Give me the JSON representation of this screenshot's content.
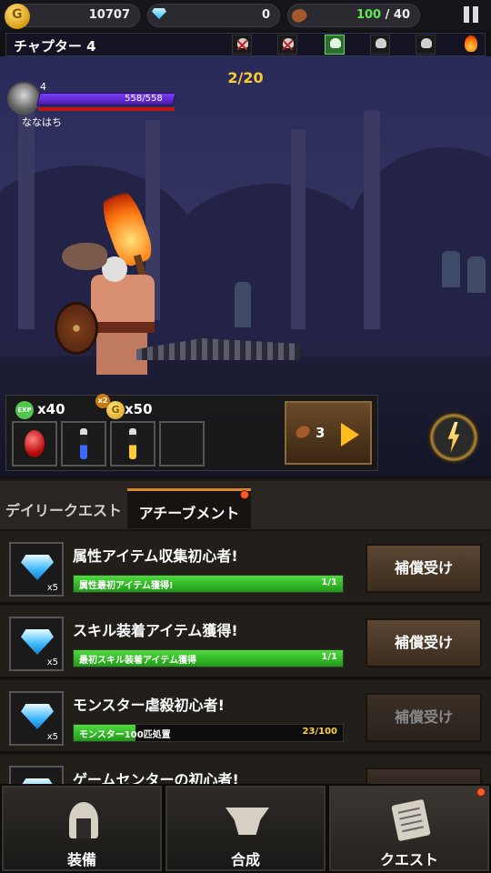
{
  "resources": {
    "gold": "10707",
    "gems": "0",
    "stamina_current": "100",
    "stamina_max": " / 40",
    "gold_icon": "gold-coin-icon",
    "gem_icon": "diamond-icon",
    "stamina_icon": "meat-icon"
  },
  "chapter": {
    "title": "チャプター 4",
    "stages": [
      "done",
      "done",
      "current",
      "pending",
      "pending",
      "boss"
    ]
  },
  "battle": {
    "wave": "2/20",
    "player_level": "4",
    "player_hp": "558/558",
    "player_name": "ななはち",
    "hp_fraction": 1.0
  },
  "rewards": {
    "exp_label": "EXP",
    "exp": "x40",
    "gold_multiplier": "x2",
    "gold": "x50",
    "slots": [
      "ruby",
      "blue-potion",
      "yellow-potion",
      "empty"
    ],
    "stamina_cost": "3"
  },
  "tabs": {
    "daily": "デイリークエスト",
    "achievement": "アチーブメント"
  },
  "quests": [
    {
      "title": "属性アイテム収集初心者!",
      "progress_label": "属性最初アイテム獲得!",
      "progress_text": "1/1",
      "progress": 1.0,
      "reward_qty": "x5",
      "claim": "補償受け",
      "claimable": true
    },
    {
      "title": "スキル装着アイテム獲得!",
      "progress_label": "最初スキル装着アイテム獲得",
      "progress_text": "1/1",
      "progress": 1.0,
      "reward_qty": "x5",
      "claim": "補償受け",
      "claimable": true
    },
    {
      "title": "モンスター虐殺初心者!",
      "progress_label": "モンスター100匹処置",
      "progress_text": "23/100",
      "progress": 0.23,
      "reward_qty": "x5",
      "claim": "補償受け",
      "claimable": false
    },
    {
      "title": "ゲームセンターの初心者!",
      "progress_label": "",
      "progress_text": "",
      "progress": 0,
      "reward_qty": "",
      "claim": "",
      "claimable": false
    }
  ],
  "nav": {
    "equip": "装備",
    "craft": "合成",
    "quest": "クエスト",
    "active": "quest"
  }
}
